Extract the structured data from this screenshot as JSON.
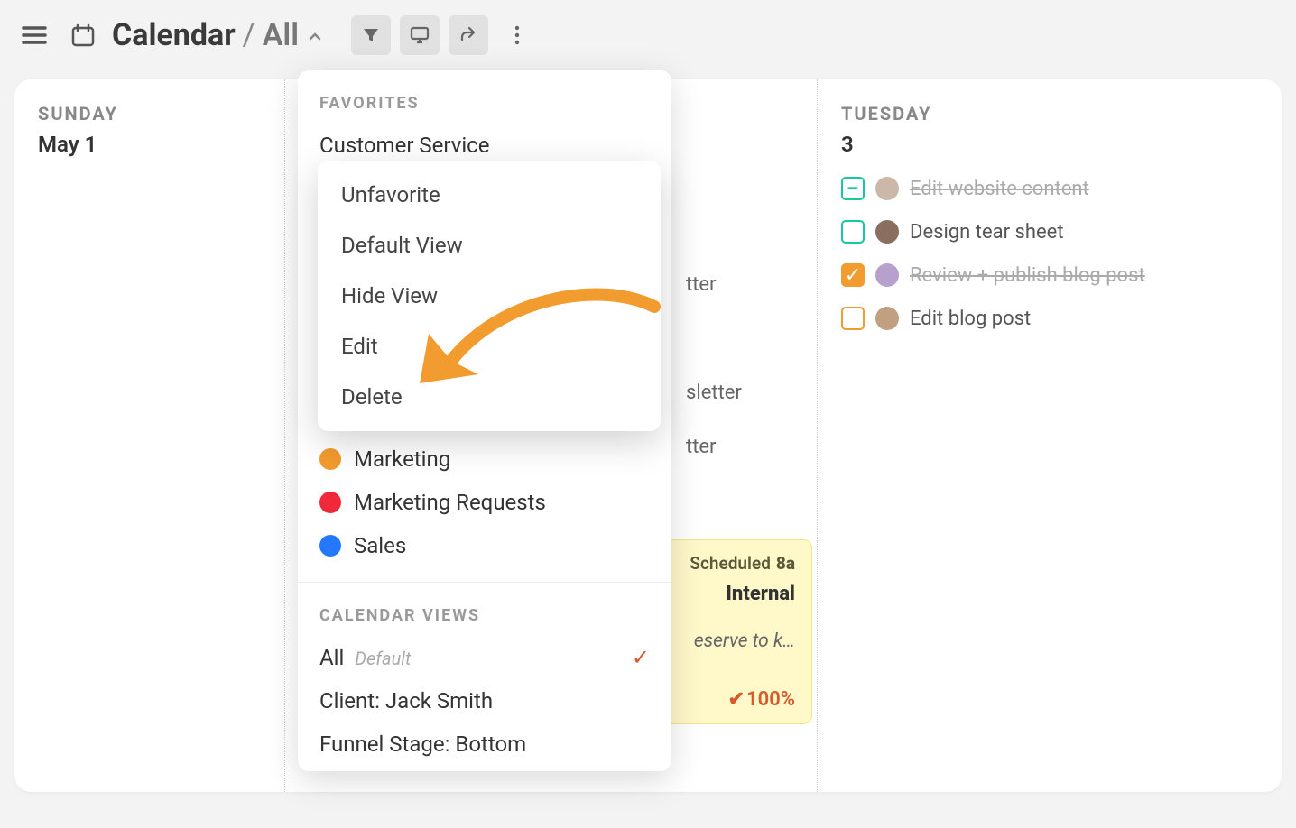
{
  "header": {
    "title": "Calendar",
    "subview": "All"
  },
  "dropdown": {
    "favorites_label": "FAVORITES",
    "favorites": [
      {
        "label": "Customer Service"
      },
      {
        "label": "Marketing",
        "color": "orange"
      },
      {
        "label": "Marketing Requests",
        "color": "red"
      },
      {
        "label": "Sales",
        "color": "blue"
      }
    ],
    "views_label": "CALENDAR VIEWS",
    "views": [
      {
        "label": "All",
        "default_tag": "Default",
        "selected": true
      },
      {
        "label": "Client: Jack Smith"
      },
      {
        "label": "Funnel Stage: Bottom"
      }
    ]
  },
  "submenu": {
    "items": [
      "Unfavorite",
      "Default View",
      "Hide View",
      "Edit",
      "Delete"
    ]
  },
  "behind_fragments": {
    "f1": "tter",
    "f2": "sletter",
    "f3": "tter"
  },
  "card": {
    "status": "Scheduled",
    "time": "8a",
    "title_suffix": "Internal",
    "desc_suffix": "eserve to k…",
    "percent": "100%"
  },
  "days": {
    "sunday": {
      "name": "SUNDAY",
      "num": "May 1"
    },
    "tuesday": {
      "name": "TUESDAY",
      "num": "3"
    }
  },
  "tuesday_tasks": [
    {
      "label": "Edit website content",
      "box": "teal-done",
      "done": true
    },
    {
      "label": "Design tear sheet",
      "box": "teal-open",
      "done": false
    },
    {
      "label": "Review + publish blog post",
      "box": "orange-done",
      "done": true
    },
    {
      "label": "Edit blog post",
      "box": "orange-open",
      "done": false
    }
  ]
}
